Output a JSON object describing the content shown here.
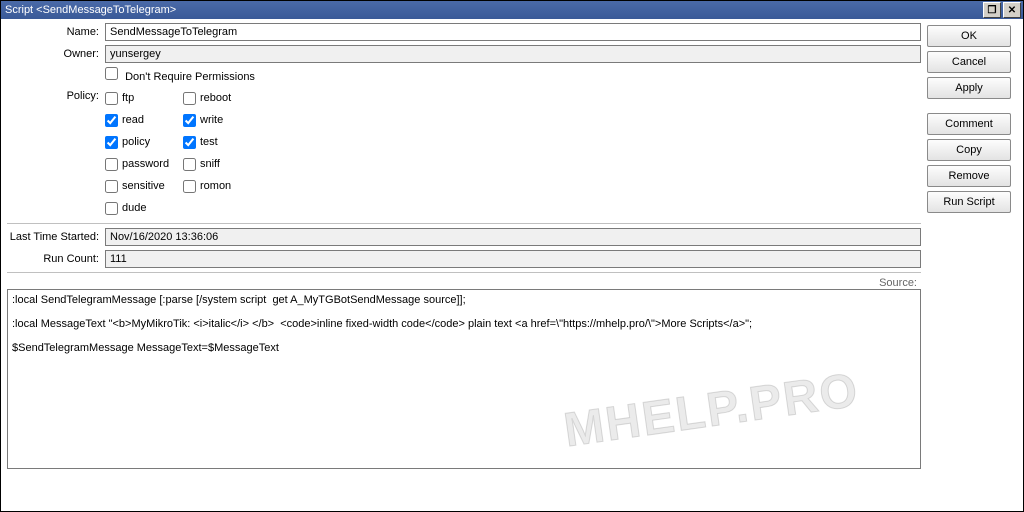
{
  "window": {
    "title": "Script <SendMessageToTelegram>"
  },
  "buttons": {
    "ok": "OK",
    "cancel": "Cancel",
    "apply": "Apply",
    "comment": "Comment",
    "copy": "Copy",
    "remove": "Remove",
    "run": "Run Script"
  },
  "labels": {
    "name": "Name:",
    "owner": "Owner:",
    "dont_require": "Don't Require Permissions",
    "policy": "Policy:",
    "last_time": "Last Time Started:",
    "run_count": "Run Count:",
    "source": "Source:"
  },
  "fields": {
    "name": "SendMessageToTelegram",
    "owner": "yunsergey",
    "last_time": "Nov/16/2020 13:36:06",
    "run_count": "111"
  },
  "policy": {
    "ftp": {
      "label": "ftp",
      "checked": false
    },
    "reboot": {
      "label": "reboot",
      "checked": false
    },
    "read": {
      "label": "read",
      "checked": true
    },
    "write": {
      "label": "write",
      "checked": true
    },
    "policy": {
      "label": "policy",
      "checked": true
    },
    "test": {
      "label": "test",
      "checked": true
    },
    "password": {
      "label": "password",
      "checked": false
    },
    "sniff": {
      "label": "sniff",
      "checked": false
    },
    "sensitive": {
      "label": "sensitive",
      "checked": false
    },
    "romon": {
      "label": "romon",
      "checked": false
    },
    "dude": {
      "label": "dude",
      "checked": false
    }
  },
  "dont_require_checked": false,
  "source": ":local SendTelegramMessage [:parse [/system script  get A_MyTGBotSendMessage source]];\n\n:local MessageText \"<b>MyMikroTik: <i>italic</i> </b>  <code>inline fixed-width code</code> plain text <a href=\\\"https://mhelp.pro/\\\">More Scripts</a>\";\n\n$SendTelegramMessage MessageText=$MessageText",
  "watermark": "MHELP.PRO"
}
